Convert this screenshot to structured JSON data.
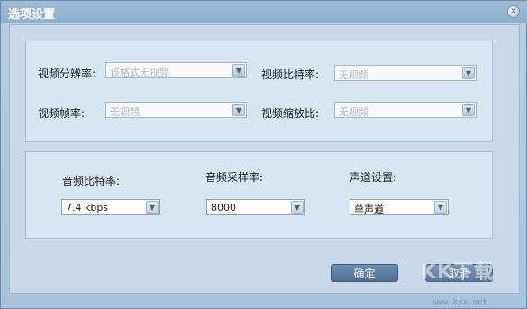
{
  "dialog": {
    "title": "选项设置",
    "close_symbol": "✕"
  },
  "video": {
    "resolution": {
      "label": "视频分辨率:",
      "value": "该格式无视频"
    },
    "bitrate": {
      "label": "视频比特率:",
      "value": "无视频"
    },
    "framerate": {
      "label": "视频帧率:",
      "value": "无视频"
    },
    "scale": {
      "label": "视频缩放比:",
      "value": "无视频"
    }
  },
  "audio": {
    "bitrate": {
      "label": "音频比特率:",
      "value": "7.4 kbps"
    },
    "samplerate": {
      "label": "音频采样率:",
      "value": "8000"
    },
    "channels": {
      "label": "声道设置:",
      "value": "单声道"
    }
  },
  "buttons": {
    "ok": "确定",
    "cancel": "取消"
  },
  "watermark": {
    "logo": "KK下载",
    "url": "www.kkx.net"
  },
  "icons": {
    "dropdown": "chevron-down-icon",
    "close": "close-icon"
  }
}
